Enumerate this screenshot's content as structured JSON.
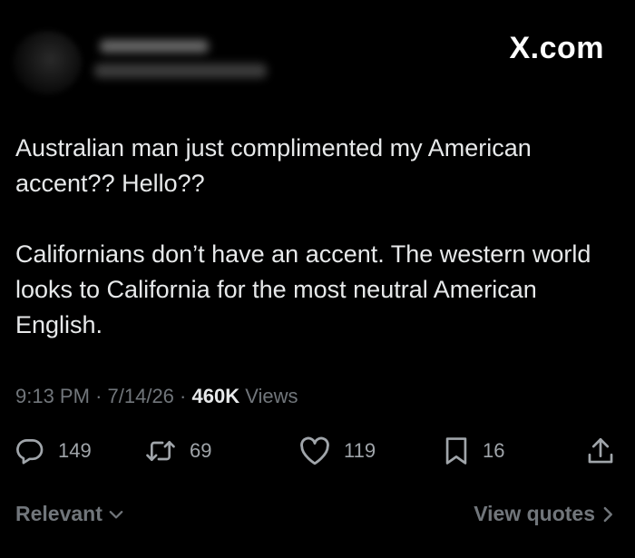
{
  "brand": "X.com",
  "tweet": {
    "paragraphs": [
      "Australian man just complimented my American accent?? Hello??",
      "Californians don’t have an accent. The western world looks to California for the most neutral American English."
    ]
  },
  "meta": {
    "time": "9:13 PM",
    "date": "7/14/26",
    "views_count": "460K",
    "views_label": "Views",
    "separator": "·"
  },
  "actions": {
    "replies": "149",
    "reposts": "69",
    "likes": "119",
    "bookmarks": "16"
  },
  "footer": {
    "sort_label": "Relevant",
    "quotes_label": "View quotes"
  },
  "icons": {
    "reply": "speech-bubble",
    "repost": "retweet-arrows",
    "like": "heart",
    "bookmark": "bookmark",
    "share": "share-upload",
    "sort": "chevron-down",
    "quotes": "chevron-right"
  }
}
